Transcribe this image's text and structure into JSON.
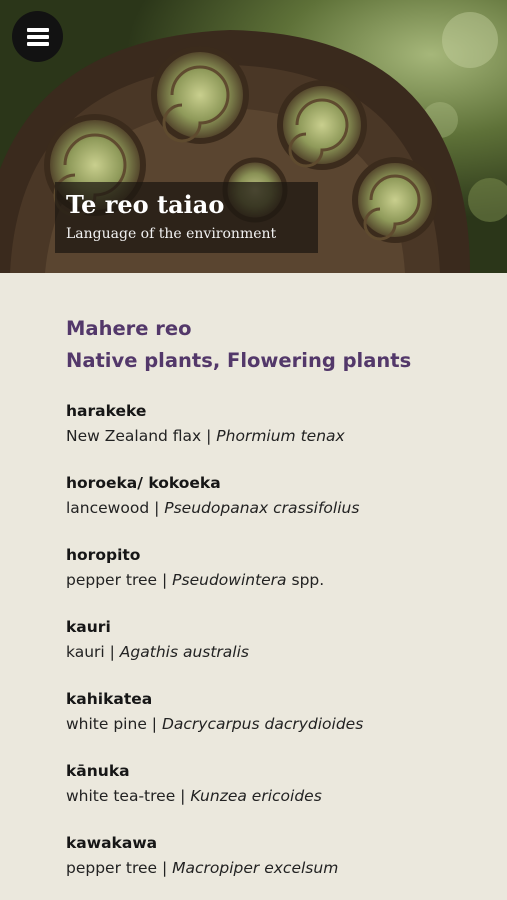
{
  "header": {
    "title": "Te reo taiao",
    "subtitle": "Language of the environment",
    "menu_icon": "hamburger-menu-icon"
  },
  "section": {
    "heading_line1": "Mahere reo",
    "heading_line2": "Native plants, Flowering plants"
  },
  "plants": [
    {
      "term": "harakeke",
      "common": "New Zealand flax",
      "separator": " | ",
      "scientific": "Phormium tenax",
      "suffix": ""
    },
    {
      "term": "horoeka/ kokoeka",
      "common": "lancewood",
      "separator": " | ",
      "scientific": "Pseudopanax crassifolius",
      "suffix": ""
    },
    {
      "term": "horopito",
      "common": "pepper tree",
      "separator": " | ",
      "scientific": "Pseudowintera",
      "suffix": " spp."
    },
    {
      "term": "kauri",
      "common": "kauri",
      "separator": " | ",
      "scientific": "Agathis australis",
      "suffix": ""
    },
    {
      "term": "kahikatea",
      "common": "white pine",
      "separator": " | ",
      "scientific": "Dacrycarpus dacrydioides",
      "suffix": ""
    },
    {
      "term": "kānuka",
      "common": "white tea-tree",
      "separator": " | ",
      "scientific": "Kunzea ericoides",
      "suffix": ""
    },
    {
      "term": "kawakawa",
      "common": "pepper tree",
      "separator": " | ",
      "scientific": "Macropiper excelsum",
      "suffix": ""
    }
  ],
  "colors": {
    "background": "#ebe8dd",
    "heading": "#53386a",
    "title_overlay": "#1c1610"
  }
}
